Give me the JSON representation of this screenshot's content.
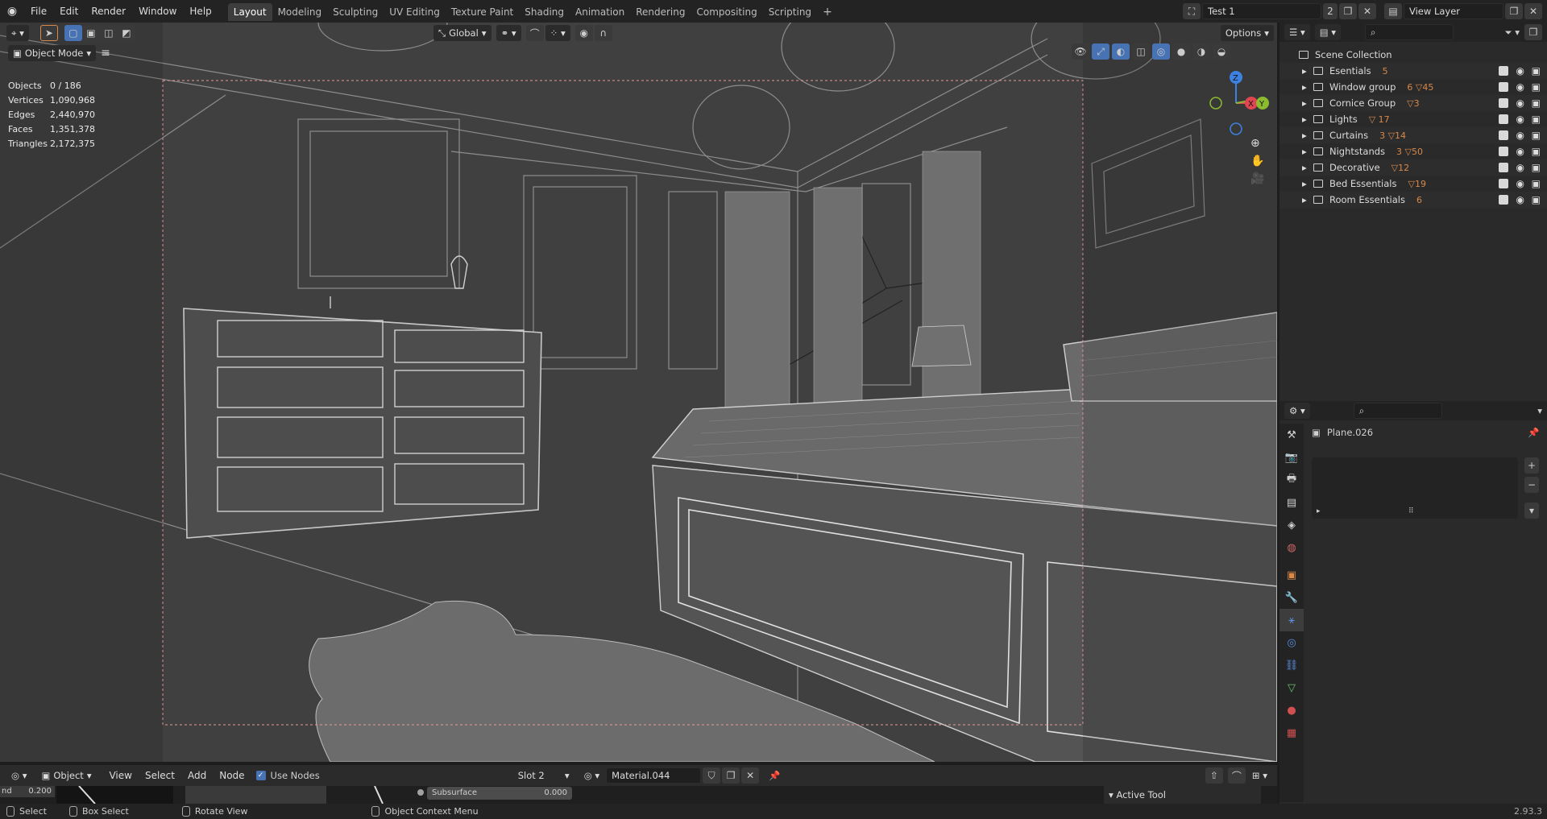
{
  "menus": [
    "File",
    "Edit",
    "Render",
    "Window",
    "Help"
  ],
  "workspaces": [
    "Layout",
    "Modeling",
    "Sculpting",
    "UV Editing",
    "Texture Paint",
    "Shading",
    "Animation",
    "Rendering",
    "Compositing",
    "Scripting"
  ],
  "active_workspace": "Layout",
  "scene": {
    "name": "Test 1",
    "users": "2"
  },
  "view_layer": "View Layer",
  "viewport": {
    "mode": "Object Mode",
    "orientation": "Global",
    "options_label": "Options",
    "gizmo_axes": {
      "x": "X",
      "y": "Y",
      "z": "Z"
    },
    "stats": [
      {
        "label": "Objects",
        "value": "0 / 186"
      },
      {
        "label": "Vertices",
        "value": "1,090,968"
      },
      {
        "label": "Edges",
        "value": "2,440,970"
      },
      {
        "label": "Faces",
        "value": "1,351,378"
      },
      {
        "label": "Triangles",
        "value": "2,172,375"
      }
    ]
  },
  "outliner": {
    "root": "Scene Collection",
    "collections": [
      {
        "name": "Esentials",
        "badge": "5"
      },
      {
        "name": "Window group",
        "badge": "6 ▽45"
      },
      {
        "name": "Cornice Group",
        "badge": "▽3"
      },
      {
        "name": "Lights",
        "badge": "▽ 17"
      },
      {
        "name": "Curtains",
        "badge": "3 ▽14"
      },
      {
        "name": "Nightstands",
        "badge": "3 ▽50"
      },
      {
        "name": "Decorative",
        "badge": "▽12"
      },
      {
        "name": "Bed Essentials",
        "badge": "▽19"
      },
      {
        "name": "Room Essentials",
        "badge": "6"
      }
    ]
  },
  "properties": {
    "object_name": "Plane.026"
  },
  "node_editor": {
    "editor_type": "Object",
    "menus": [
      "View",
      "Select",
      "Add",
      "Node"
    ],
    "use_nodes_label": "Use Nodes",
    "slot": "Slot 2",
    "material": "Material.044",
    "left_value_label": "nd",
    "left_value": "0.200",
    "subsurface_label": "Subsurface",
    "subsurface_value": "0.000",
    "active_tool": "Active Tool"
  },
  "status": {
    "select": "Select",
    "box_select": "Box Select",
    "rotate": "Rotate View",
    "context_menu": "Object Context Menu",
    "version": "2.93.3"
  },
  "colors": {
    "x_axis": "#e04552",
    "y_axis": "#8bbb2f",
    "z_axis": "#3d82e0",
    "accent": "#4772b3",
    "badge": "#d8894a"
  }
}
